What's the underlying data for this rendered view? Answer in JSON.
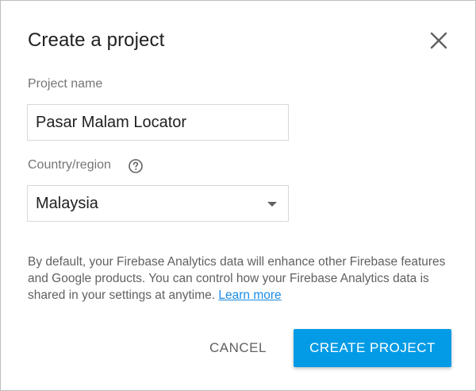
{
  "dialog": {
    "title": "Create a project",
    "close_icon": "close-icon"
  },
  "project_name": {
    "label": "Project name",
    "value": "Pasar Malam Locator"
  },
  "country": {
    "label": "Country/region",
    "help_icon": "help-circle-icon",
    "selected": "Malaysia",
    "arrow_icon": "dropdown-arrow-icon"
  },
  "info": {
    "text": "By default, your Firebase Analytics data will enhance other Firebase features and Google products. You can control how your Firebase Analytics data is shared in your settings at anytime.",
    "link_label": "Learn more"
  },
  "actions": {
    "cancel_label": "CANCEL",
    "create_label": "CREATE PROJECT"
  },
  "colors": {
    "primary": "#039be5",
    "link": "#1a8be5",
    "title": "#212121",
    "label": "#757575"
  }
}
